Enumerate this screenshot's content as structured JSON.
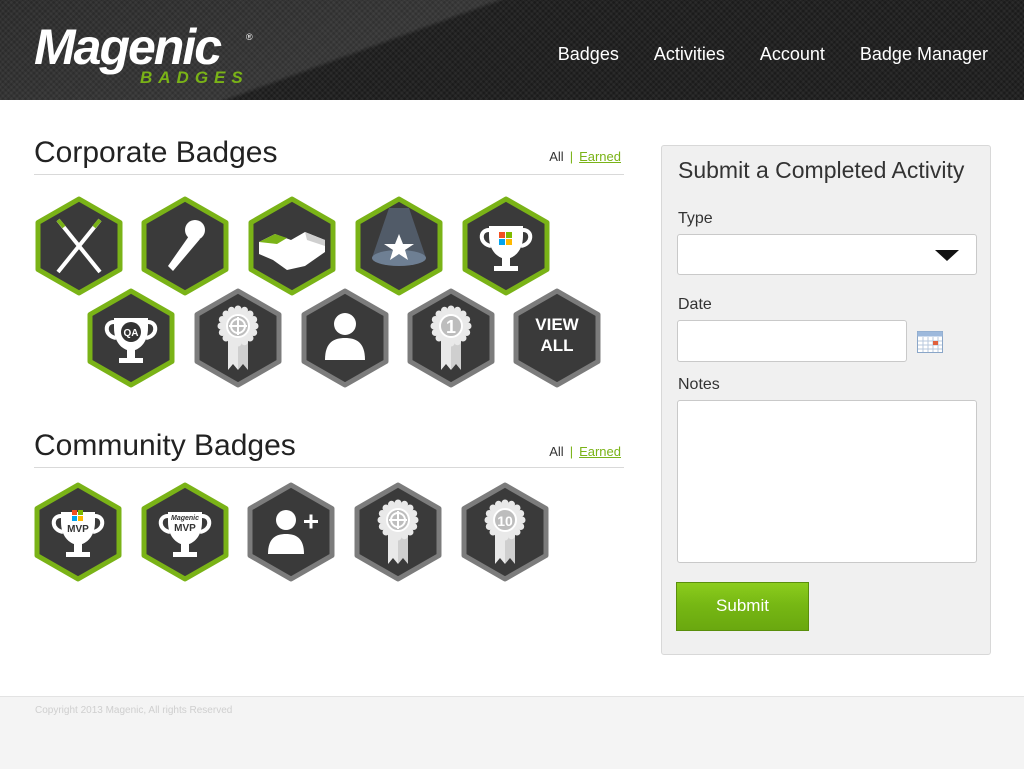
{
  "logo": {
    "main": "Magenic",
    "sub": "BADGES",
    "registered": "®"
  },
  "nav": {
    "items": [
      {
        "label": "Badges"
      },
      {
        "label": "Activities"
      },
      {
        "label": "Account"
      },
      {
        "label": "Badge Manager"
      }
    ]
  },
  "corporate": {
    "title": "Corporate Badges",
    "link_all": "All",
    "link_sep": "|",
    "link_earned": "Earned",
    "badges": [
      {
        "icon": "crossed-batons-icon",
        "earned": true
      },
      {
        "icon": "microphone-icon",
        "earned": true
      },
      {
        "icon": "handshake-icon",
        "earned": true
      },
      {
        "icon": "spotlight-star-icon",
        "earned": true
      },
      {
        "icon": "windows-trophy-icon",
        "earned": true
      },
      {
        "icon": "qa-trophy-icon",
        "earned": true,
        "text": "QA"
      },
      {
        "icon": "crosshair-ribbon-icon",
        "earned": false
      },
      {
        "icon": "person-icon",
        "earned": false
      },
      {
        "icon": "number-one-ribbon-icon",
        "earned": false,
        "text": "1"
      },
      {
        "icon": "view-all-icon",
        "earned": false,
        "line1": "VIEW",
        "line2": "ALL"
      }
    ]
  },
  "community": {
    "title": "Community Badges",
    "link_all": "All",
    "link_sep": "|",
    "link_earned": "Earned",
    "badges": [
      {
        "icon": "windows-mvp-trophy-icon",
        "earned": true,
        "text": "MVP"
      },
      {
        "icon": "magenic-mvp-trophy-icon",
        "earned": true,
        "brand": "Magenic",
        "text": "MVP"
      },
      {
        "icon": "add-person-icon",
        "earned": false
      },
      {
        "icon": "crosshair-ribbon-icon",
        "earned": false
      },
      {
        "icon": "number-ten-ribbon-icon",
        "earned": false,
        "text": "10"
      }
    ]
  },
  "form": {
    "title": "Submit a Completed Activity",
    "type_label": "Type",
    "type_value": "",
    "date_label": "Date",
    "date_value": "",
    "notes_label": "Notes",
    "notes_value": "",
    "submit_label": "Submit"
  },
  "footer": {
    "copyright": "Copyright 2013 Magenic, All rights Reserved"
  },
  "colors": {
    "brand_green": "#7ab317",
    "hex_dark": "#3a3a3a",
    "hex_border_gray": "#7c7c7c",
    "header_bg": "#1b1b1b"
  }
}
